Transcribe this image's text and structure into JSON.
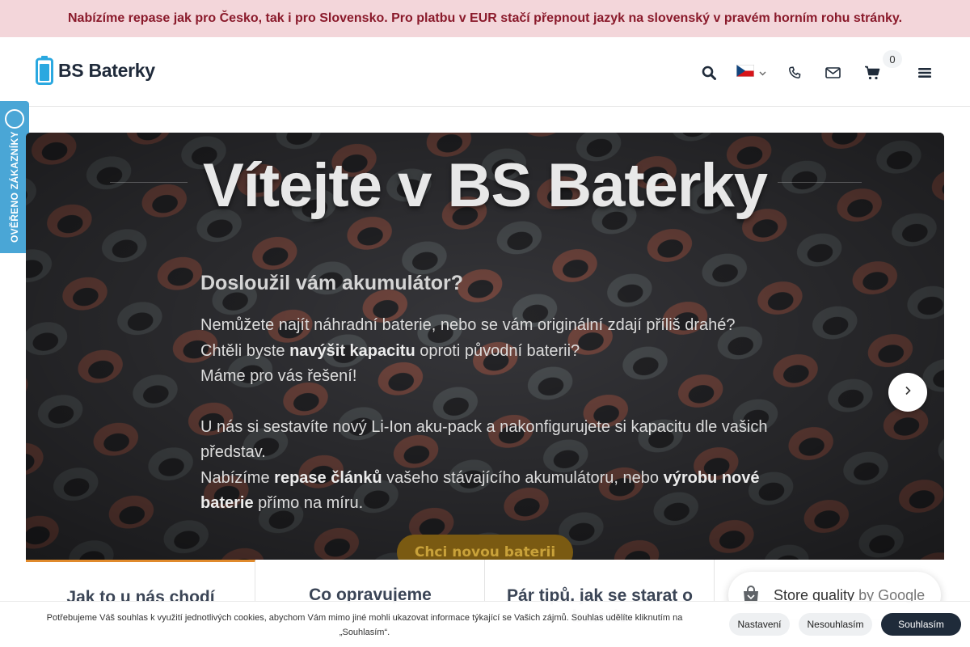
{
  "announcement": "Nabízíme repase jak pro Česko, tak i pro Slovensko. Pro platbu v EUR stačí přepnout jazyk na slovenský v pravém horním rohu stránky.",
  "header": {
    "logo_text": "BS Baterky",
    "cart_count": "0",
    "icons": [
      "search-icon",
      "flag-cz-icon",
      "phone-icon",
      "envelope-icon",
      "cart-icon",
      "menu-icon"
    ]
  },
  "side_badge": {
    "text": "OVĚŘENO ZÁKAZNÍKY"
  },
  "hero": {
    "title": "Vítejte v BS Baterky",
    "subtitle": "Dosloužil vám akumulátor?",
    "p1_line1": "Nemůžete najít náhradní baterie, nebo se vám originální zdají příliš drahé?",
    "p1_line2_a": "Chtěli byste ",
    "p1_line2_b": "navýšit kapacitu",
    "p1_line2_c": " oproti původní baterii?",
    "p1_line3": "Máme pro vás řešení!",
    "p2_line1": "U nás si sestavíte nový Li-Ion aku-pack a nakonfigurujete si kapacitu dle vašich představ.",
    "p2_line2_a": "Nabízíme ",
    "p2_line2_b": "repase článků",
    "p2_line2_c": " vašeho stávajícího akumulátoru, nebo ",
    "p2_line2_d": "výrobu nové baterie",
    "p2_line2_e": " přímo na míru.",
    "cta": "Chci novou baterii"
  },
  "cards": [
    {
      "title": "Jak to u nás chodí"
    },
    {
      "title": "Co opravujeme"
    },
    {
      "title": "Pár tipů, jak se starat o baterie"
    },
    {
      "title": ""
    }
  ],
  "google_badge": {
    "label": "Store quality",
    "by": "by Google"
  },
  "cookie": {
    "text": "Potřebujeme Váš souhlas k využití jednotlivých cookies, abychom Vám mimo jiné mohli ukazovat informace týkající se Vašich zájmů. Souhlas udělíte kliknutím na „Souhlasím“.",
    "settings": "Nastavení",
    "decline": "Nesouhlasím",
    "accept": "Souhlasím"
  },
  "colors": {
    "announcement_bg": "#f3d6da",
    "announcement_text": "#8a1a2b",
    "accent_orange": "#e08a2c",
    "badge_blue": "#4aa6d6",
    "logo_blue": "#2aa8e0",
    "cookie_accept": "#1f2b3a"
  }
}
